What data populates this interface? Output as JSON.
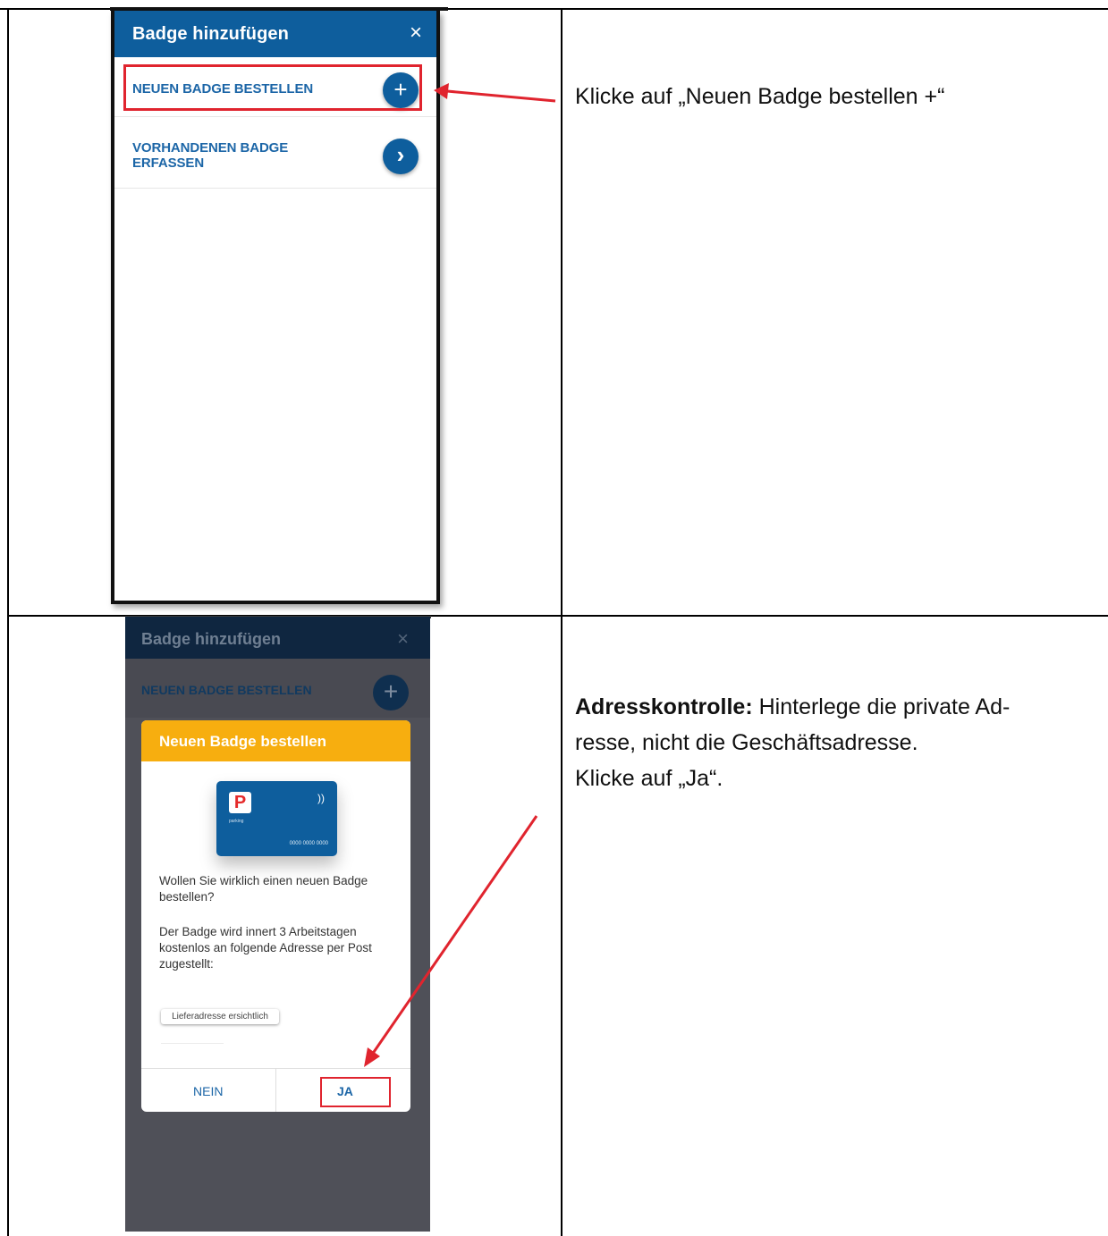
{
  "step1": {
    "screen_title": "Badge hinzufügen",
    "close_glyph": "×",
    "order_new_label": "NEUEN BADGE BESTELLEN",
    "order_new_icon": "+",
    "register_existing_line1": "VORHANDENEN BADGE",
    "register_existing_line2": "ERFASSEN",
    "register_existing_icon": "›",
    "instruction": "Klicke auf „Neuen Badge bestellen +“"
  },
  "step2": {
    "screen_title": "Badge hinzufügen",
    "close_glyph": "×",
    "order_new_label": "NEUEN BADGE BESTELLEN",
    "order_new_icon": "+",
    "dialog": {
      "title": "Neuen Badge bestellen",
      "card_logo": "P",
      "card_nfc": "))",
      "card_brand": "parking",
      "card_number": "0000 0000 0000",
      "question": "Wollen Sie wirklich einen neuen Badge bestellen?",
      "info": "Der Badge wird innert 3 Arbeitstagen kostenlos an folgende Adresse per Post zugestellt:",
      "address_chip": "Lieferadresse ersichtlich",
      "no_button": "NEIN",
      "yes_button": "JA"
    },
    "instruction_bold": "Adresskontrolle:",
    "instruction_line1": " Hinterlege die private Ad-",
    "instruction_line2": "resse, nicht die Geschäftsadresse.",
    "instruction_line3": "Klicke auf „Ja“."
  },
  "colors": {
    "app_blue": "#0e5e9d",
    "dialog_orange": "#f7ae0f",
    "highlight_red": "#e0242e"
  }
}
